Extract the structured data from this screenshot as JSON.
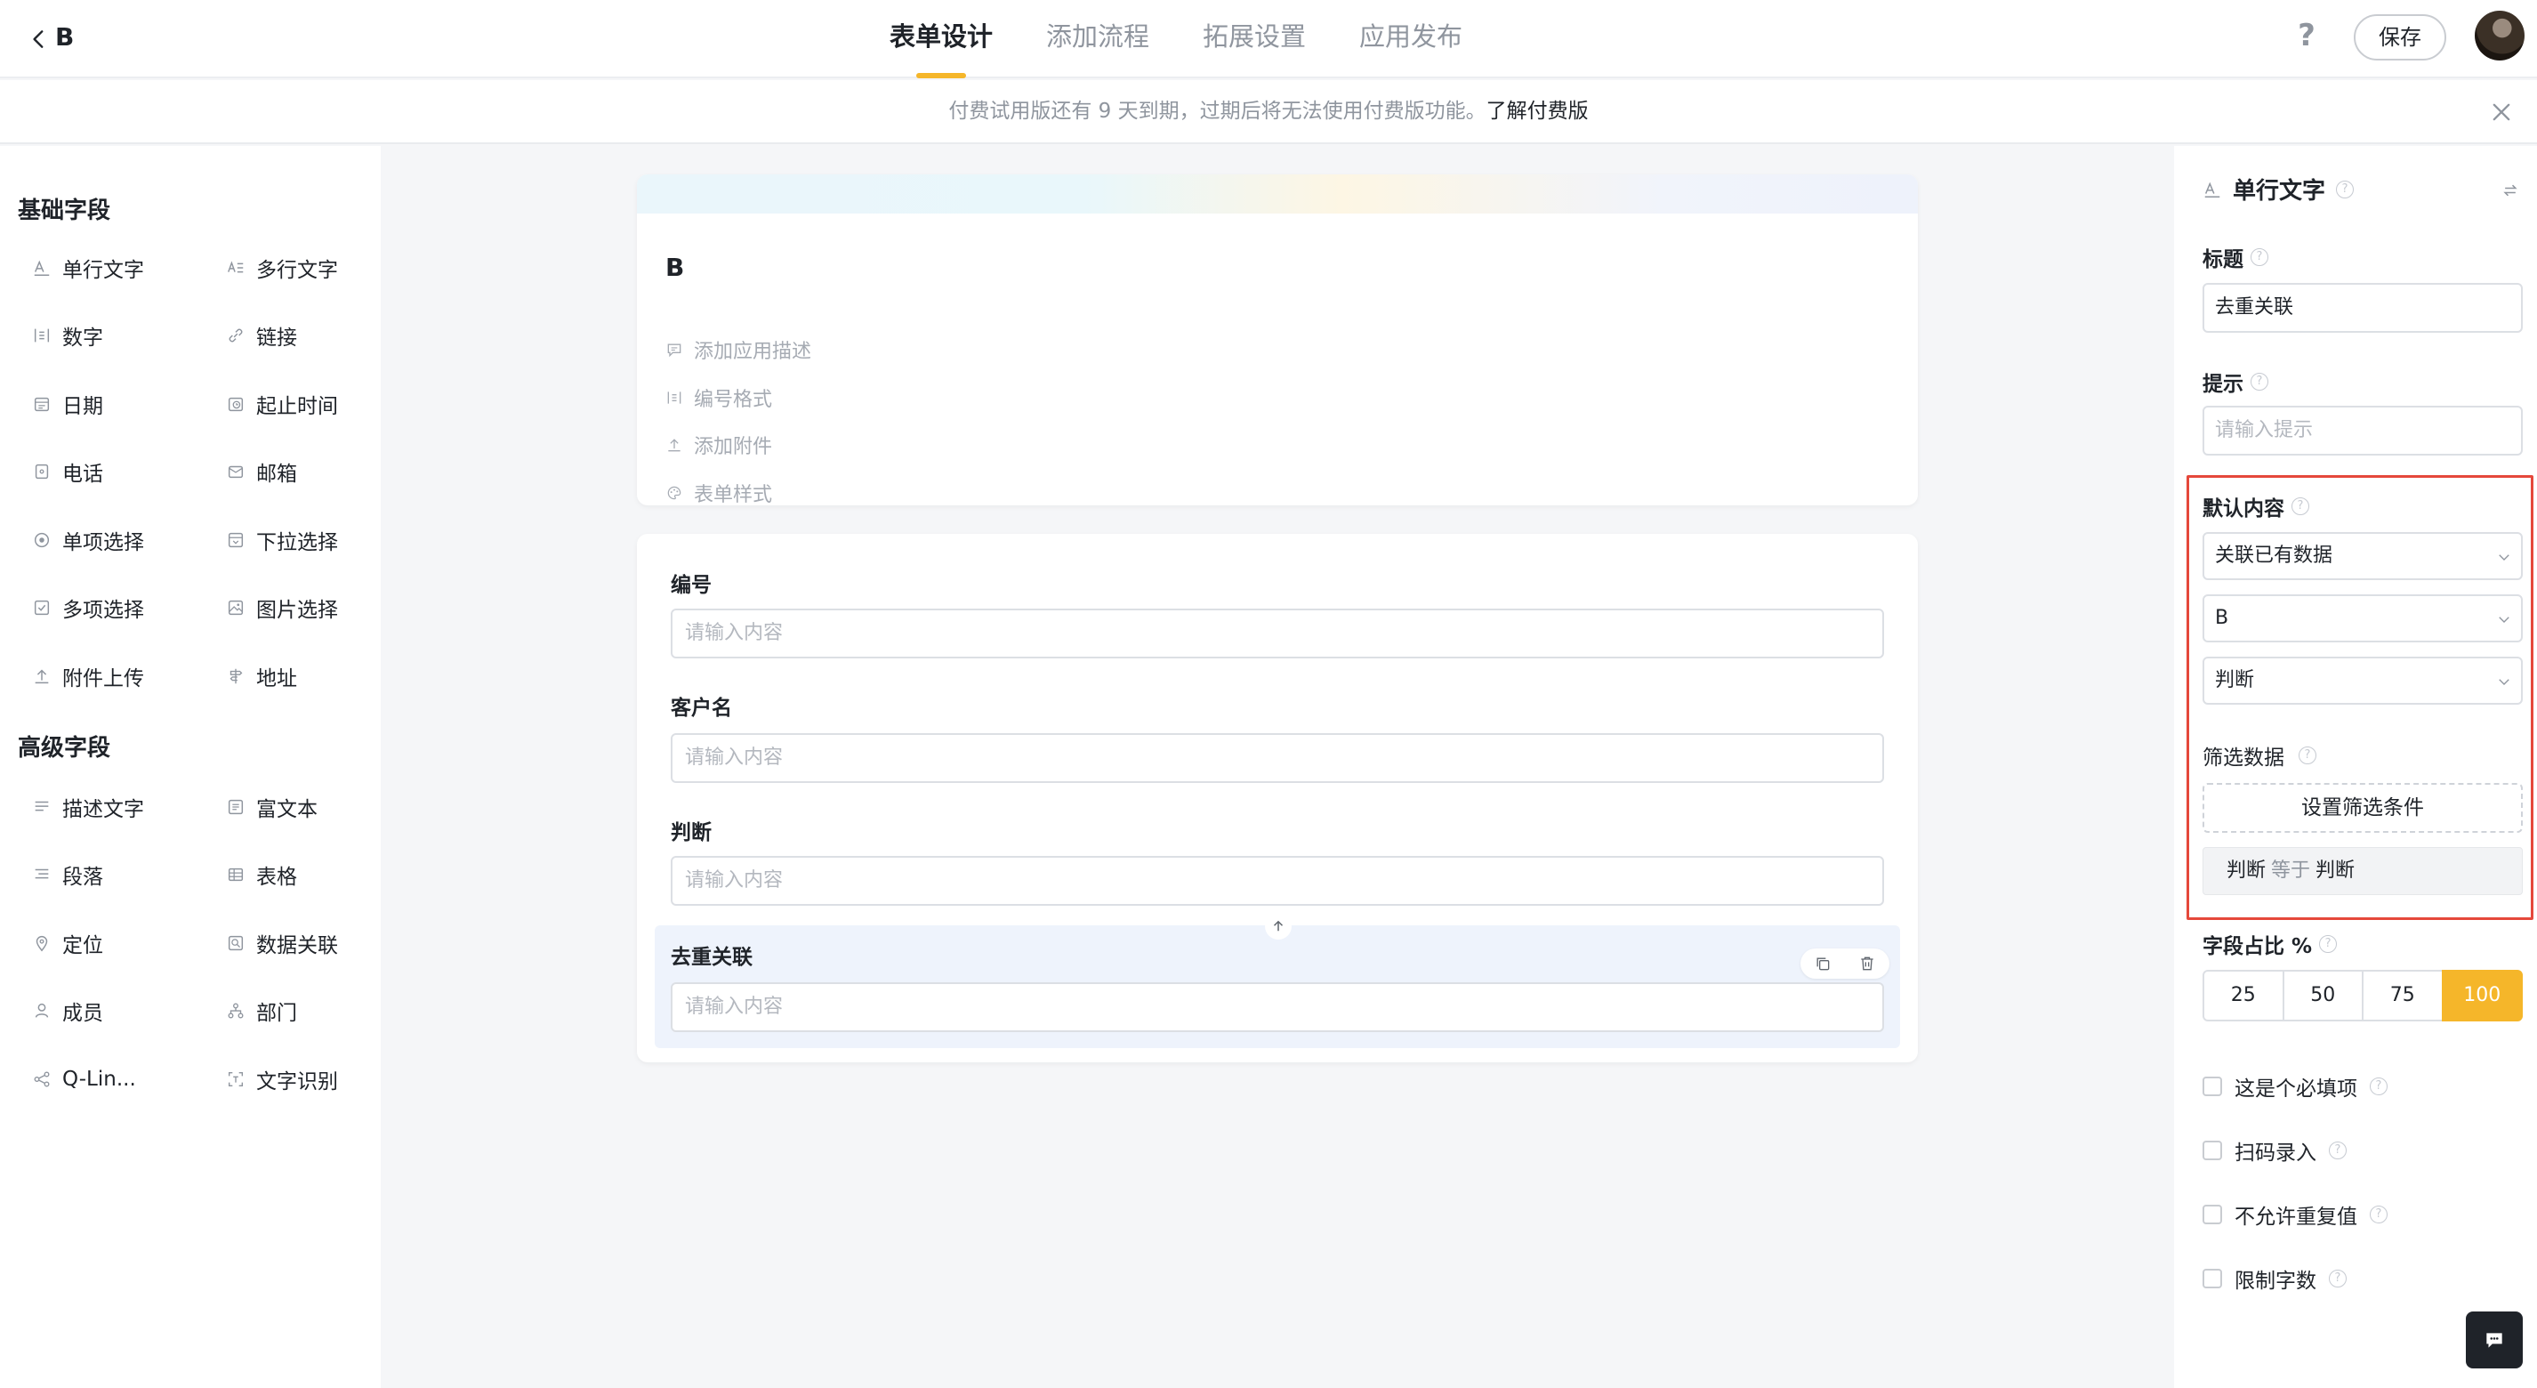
{
  "header": {
    "back_label": "",
    "app_name": "B",
    "tabs": [
      {
        "label": "表单设计",
        "active": true
      },
      {
        "label": "添加流程",
        "active": false
      },
      {
        "label": "拓展设置",
        "active": false
      },
      {
        "label": "应用发布",
        "active": false
      }
    ],
    "help_label": "?",
    "save_label": "保存"
  },
  "notice": {
    "text": "付费试用版还有 9 天到期，过期后将无法使用付费版功能。",
    "link": "了解付费版"
  },
  "palette": {
    "basic_title": "基础字段",
    "basic_fields": [
      {
        "label": "单行文字",
        "icon": "text-icon"
      },
      {
        "label": "多行文字",
        "icon": "multiline-text-icon"
      },
      {
        "label": "数字",
        "icon": "number-icon"
      },
      {
        "label": "链接",
        "icon": "link-icon"
      },
      {
        "label": "日期",
        "icon": "calendar-icon"
      },
      {
        "label": "起止时间",
        "icon": "time-range-icon"
      },
      {
        "label": "电话",
        "icon": "phone-icon"
      },
      {
        "label": "邮箱",
        "icon": "mail-icon"
      },
      {
        "label": "单项选择",
        "icon": "radio-icon"
      },
      {
        "label": "下拉选择",
        "icon": "dropdown-icon"
      },
      {
        "label": "多项选择",
        "icon": "checkbox-icon"
      },
      {
        "label": "图片选择",
        "icon": "image-icon"
      },
      {
        "label": "附件上传",
        "icon": "upload-icon"
      },
      {
        "label": "地址",
        "icon": "signpost-icon"
      }
    ],
    "advanced_title": "高级字段",
    "advanced_fields": [
      {
        "label": "描述文字",
        "icon": "description-icon"
      },
      {
        "label": "富文本",
        "icon": "rich-text-icon"
      },
      {
        "label": "段落",
        "icon": "paragraph-icon"
      },
      {
        "label": "表格",
        "icon": "table-icon"
      },
      {
        "label": "定位",
        "icon": "location-pin-icon"
      },
      {
        "label": "数据关联",
        "icon": "data-link-icon"
      },
      {
        "label": "成员",
        "icon": "member-icon"
      },
      {
        "label": "部门",
        "icon": "department-icon"
      },
      {
        "label": "Q-Lin...",
        "icon": "share-icon"
      },
      {
        "label": "文字识别",
        "icon": "scan-text-icon"
      }
    ]
  },
  "form": {
    "title": "B",
    "meta": [
      {
        "label": "添加应用描述",
        "icon": "comment-icon"
      },
      {
        "label": "编号格式",
        "icon": "number-icon"
      },
      {
        "label": "添加附件",
        "icon": "upload-icon"
      },
      {
        "label": "表单样式",
        "icon": "palette-icon"
      }
    ],
    "fields": [
      {
        "label": "编号",
        "placeholder": "请输入内容"
      },
      {
        "label": "客户名",
        "placeholder": "请输入内容"
      },
      {
        "label": "判断",
        "placeholder": "请输入内容"
      },
      {
        "label": "去重关联",
        "placeholder": "请输入内容"
      }
    ]
  },
  "props": {
    "field_type": "单行文字",
    "title_label": "标题",
    "title_value": "去重关联",
    "hint_label": "提示",
    "hint_placeholder": "请输入提示",
    "default_label": "默认内容",
    "default_mode": "关联已有数据",
    "default_app": "B",
    "default_field": "判断",
    "filter_label": "筛选数据",
    "filter_button": "设置筛选条件",
    "condition": {
      "field": "判断",
      "op": "等于",
      "value": "判断"
    },
    "ratio_label": "字段占比 %",
    "ratio_options": [
      "25",
      "50",
      "75",
      "100"
    ],
    "ratio_selected": "100",
    "checks": [
      {
        "label": "这是个必填项",
        "checked": false
      },
      {
        "label": "扫码录入",
        "checked": false
      },
      {
        "label": "不允许重复值",
        "checked": false
      },
      {
        "label": "限制字数",
        "checked": false
      }
    ]
  },
  "colors": {
    "accent": "#f5b62a",
    "highlight": "#e5483b",
    "selected_bg": "#eef3fc"
  }
}
